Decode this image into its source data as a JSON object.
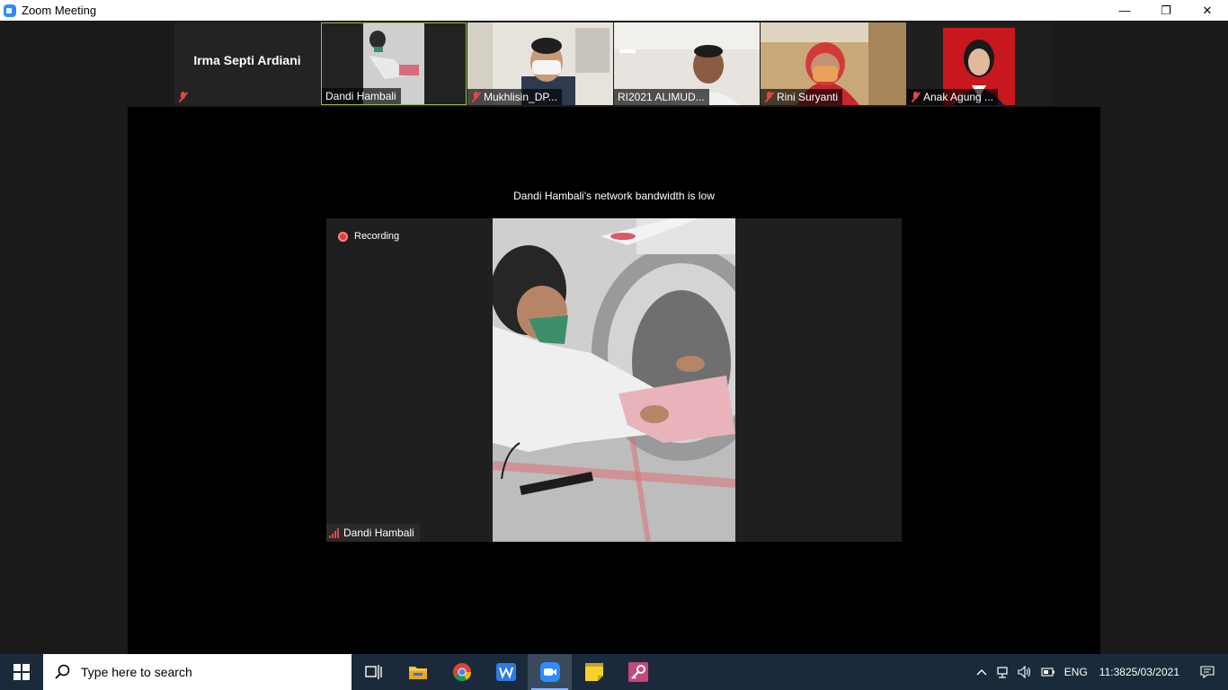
{
  "window": {
    "title": "Zoom Meeting",
    "minimize": "—",
    "restore": "❐",
    "close": "✕"
  },
  "participants": [
    {
      "name": "Irma Septi Ardiani",
      "video": false,
      "muted": true
    },
    {
      "name": "Dandi Hambali",
      "video": true,
      "muted": false,
      "active": true
    },
    {
      "name": "Mukhlisin_DP...",
      "video": true,
      "muted": true
    },
    {
      "name": "RI2021 ALIMUD...",
      "video": true,
      "muted": false
    },
    {
      "name": "Rini Suryanti",
      "video": true,
      "muted": true
    },
    {
      "name": "Anak Agung ...",
      "video": true,
      "muted": true
    }
  ],
  "main": {
    "bandwidth_notice": "Dandi Hambali's network bandwidth is low",
    "recording_label": "Recording",
    "speaker_name": "Dandi Hambali"
  },
  "taskbar": {
    "search_placeholder": "Type here to search",
    "language": "ENG",
    "time": "11:38",
    "date": "25/03/2021"
  },
  "colors": {
    "active_border": "#99c24d",
    "mute_red": "#e0464a",
    "recording_red": "#e33b3b"
  }
}
